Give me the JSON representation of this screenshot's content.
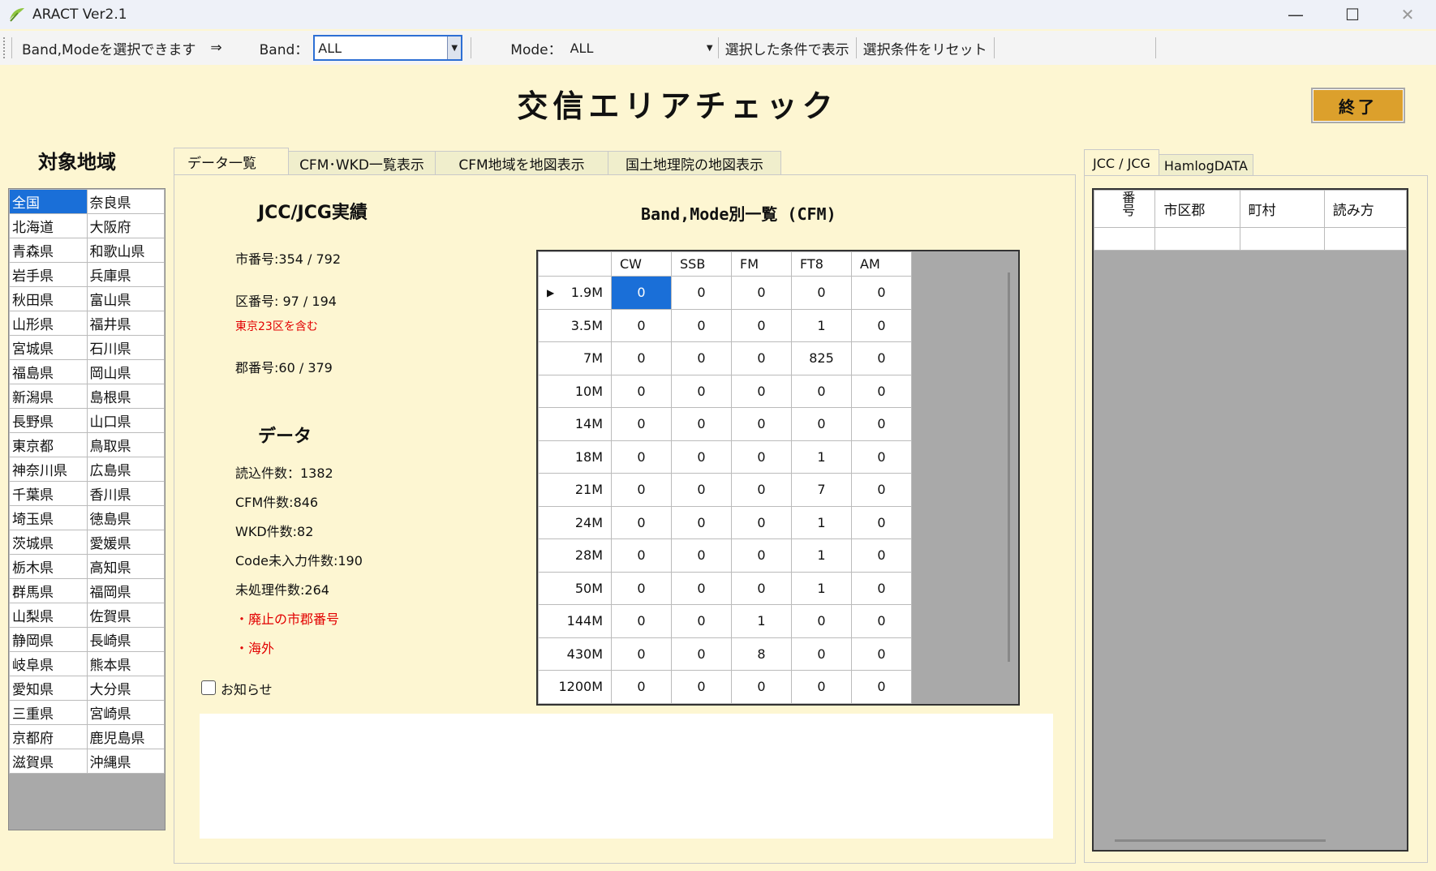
{
  "window": {
    "title": "ARACT Ver2.1",
    "minimize": "—",
    "maximize": "☐",
    "close": "✕"
  },
  "toolbar": {
    "hint": "Band,Modeを選択できます",
    "arrow": "⇒",
    "band_label": "Band：",
    "band_value": "ALL",
    "mode_label": "Mode：",
    "mode_value": "ALL",
    "show_button": "選択した条件で表示",
    "reset_button": "選択条件をリセット"
  },
  "main_title": "交信エリアチェック",
  "exit_button": "終了",
  "regions": {
    "heading": "対象地域",
    "rows": [
      [
        "全国",
        "奈良県"
      ],
      [
        "北海道",
        "大阪府"
      ],
      [
        "青森県",
        "和歌山県"
      ],
      [
        "岩手県",
        "兵庫県"
      ],
      [
        "秋田県",
        "富山県"
      ],
      [
        "山形県",
        "福井県"
      ],
      [
        "宮城県",
        "石川県"
      ],
      [
        "福島県",
        "岡山県"
      ],
      [
        "新潟県",
        "島根県"
      ],
      [
        "長野県",
        "山口県"
      ],
      [
        "東京都",
        "鳥取県"
      ],
      [
        "神奈川県",
        "広島県"
      ],
      [
        "千葉県",
        "香川県"
      ],
      [
        "埼玉県",
        "徳島県"
      ],
      [
        "茨城県",
        "愛媛県"
      ],
      [
        "栃木県",
        "高知県"
      ],
      [
        "群馬県",
        "福岡県"
      ],
      [
        "山梨県",
        "佐賀県"
      ],
      [
        "静岡県",
        "長崎県"
      ],
      [
        "岐阜県",
        "熊本県"
      ],
      [
        "愛知県",
        "大分県"
      ],
      [
        "三重県",
        "宮崎県"
      ],
      [
        "京都府",
        "鹿児島県"
      ],
      [
        "滋賀県",
        "沖縄県"
      ]
    ],
    "selected": "全国"
  },
  "tabs": [
    "データ一覧",
    "CFM･WKD一覧表示",
    "CFM地域を地図表示",
    "国土地理院の地図表示"
  ],
  "stats": {
    "heading": "JCC/JCG実績",
    "city": "市番号:354 / 792",
    "ward": "区番号: 97 / 194",
    "ward_note": "東京23区を含む",
    "county": "郡番号:60 / 379",
    "data_heading": "データ",
    "loaded": "読込件数：1382",
    "cfm": "CFM件数:846",
    "wkd": "WKD件数:82",
    "no_code": "Code未入力件数:190",
    "unprocessed": "未処理件数:264",
    "abolished": "・廃止の市郡番号",
    "overseas": "・海外",
    "notice_label": "お知らせ"
  },
  "band_table": {
    "title": "Band,Mode別一覧 (CFM)",
    "columns": [
      "CW",
      "SSB",
      "FM",
      "FT8",
      "AM"
    ],
    "rows": [
      {
        "band": "1.9M",
        "values": [
          "0",
          "0",
          "0",
          "0",
          "0"
        ]
      },
      {
        "band": "3.5M",
        "values": [
          "0",
          "0",
          "0",
          "1",
          "0"
        ]
      },
      {
        "band": "7M",
        "values": [
          "0",
          "0",
          "0",
          "825",
          "0"
        ]
      },
      {
        "band": "10M",
        "values": [
          "0",
          "0",
          "0",
          "0",
          "0"
        ]
      },
      {
        "band": "14M",
        "values": [
          "0",
          "0",
          "0",
          "0",
          "0"
        ]
      },
      {
        "band": "18M",
        "values": [
          "0",
          "0",
          "0",
          "1",
          "0"
        ]
      },
      {
        "band": "21M",
        "values": [
          "0",
          "0",
          "0",
          "7",
          "0"
        ]
      },
      {
        "band": "24M",
        "values": [
          "0",
          "0",
          "0",
          "1",
          "0"
        ]
      },
      {
        "band": "28M",
        "values": [
          "0",
          "0",
          "0",
          "1",
          "0"
        ]
      },
      {
        "band": "50M",
        "values": [
          "0",
          "0",
          "0",
          "1",
          "0"
        ]
      },
      {
        "band": "144M",
        "values": [
          "0",
          "0",
          "1",
          "0",
          "0"
        ]
      },
      {
        "band": "430M",
        "values": [
          "0",
          "0",
          "8",
          "0",
          "0"
        ]
      },
      {
        "band": "1200M",
        "values": [
          "0",
          "0",
          "0",
          "0",
          "0"
        ]
      }
    ]
  },
  "right_tabs": [
    "JCC / JCG",
    "HamlogDATA"
  ],
  "right_table": {
    "columns": [
      "番号",
      "市区郡",
      "町村",
      "読み方"
    ]
  }
}
